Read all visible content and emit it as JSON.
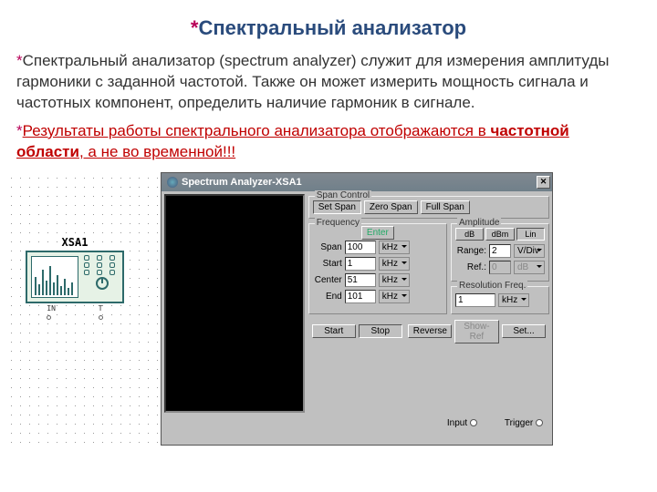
{
  "title": "Спектральный анализатор",
  "para1": "Спектральный анализатор (spectrum analyzer) служит для измерения амплитуды гармоники с заданной частотой. Также он может измерить мощность сигнала и частотных компонент, определить наличие гармоник в сигнале.",
  "para2_a": "Результаты работы спектрального анализатора отображаются в ",
  "para2_b": "частотной области",
  "para2_c": ", а не во временной!!!",
  "component": {
    "label": "XSA1",
    "pin_in": "IN",
    "pin_t": "T"
  },
  "analyzer": {
    "title": "Spectrum Analyzer-XSA1",
    "span_control": {
      "label": "Span Control",
      "set_span": "Set Span",
      "zero_span": "Zero Span",
      "full_span": "Full Span"
    },
    "frequency": {
      "label": "Frequency",
      "enter": "Enter",
      "span_label": "Span",
      "span_value": "100",
      "span_unit": "kHz",
      "start_label": "Start",
      "start_value": "1",
      "start_unit": "kHz",
      "center_label": "Center",
      "center_value": "51",
      "center_unit": "kHz",
      "end_label": "End",
      "end_value": "101",
      "end_unit": "kHz"
    },
    "amplitude": {
      "label": "Amplitude",
      "db": "dB",
      "dbm": "dBm",
      "lin": "Lin",
      "range_label": "Range:",
      "range_value": "2",
      "range_unit": "V/Div",
      "ref_label": "Ref.:",
      "ref_value": "0",
      "ref_unit": "dB"
    },
    "resolution": {
      "label": "Resolution Freq.",
      "value": "1",
      "unit": "kHz"
    },
    "actions": {
      "start": "Start",
      "stop": "Stop",
      "reverse": "Reverse",
      "show_ref": "Show-Ref",
      "set": "Set..."
    },
    "footer": {
      "input": "Input",
      "trigger": "Trigger"
    }
  }
}
